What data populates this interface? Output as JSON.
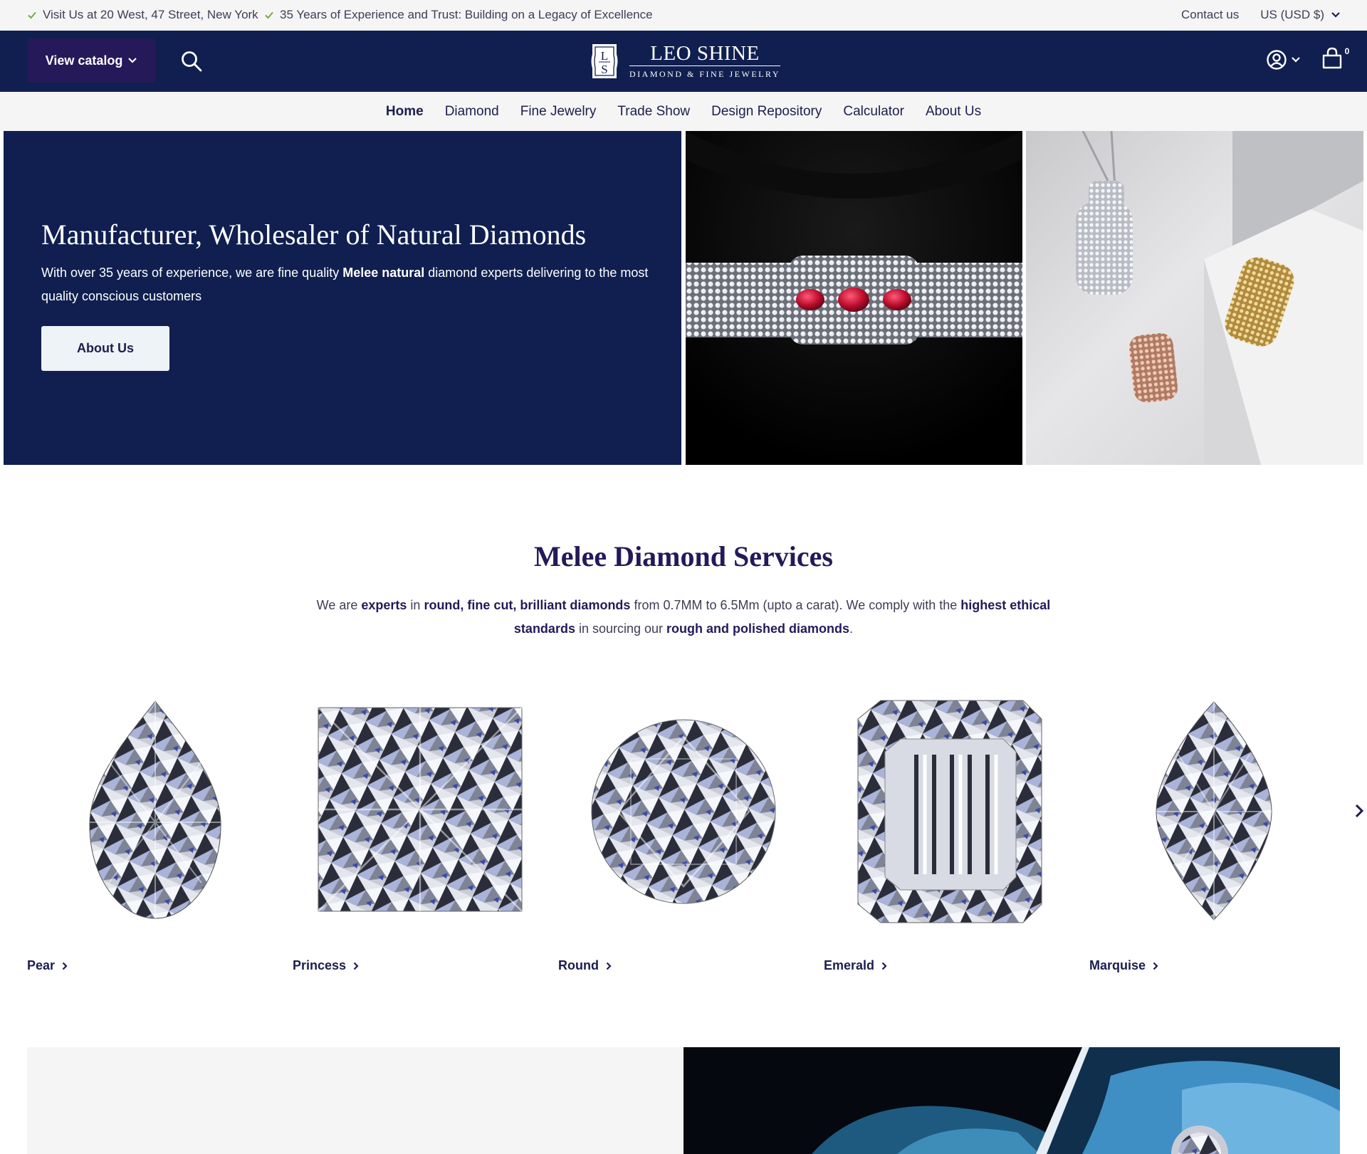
{
  "announcement": {
    "items": [
      "Visit Us at 20 West, 47 Street, New York",
      "35 Years of Experience and Trust: Building on a Legacy of Excellence"
    ],
    "contact": "Contact us",
    "currency": "US (USD $)",
    "check_color": "#6fae3a"
  },
  "header": {
    "catalog_label": "View catalog",
    "logo": {
      "monogram_top": "L",
      "monogram_bottom": "S",
      "brand": "LEO SHINE",
      "tagline": "DIAMOND & FINE JEWELRY"
    },
    "cart_count": "0",
    "background": "#101f4f"
  },
  "nav": {
    "items": [
      "Home",
      "Diamond",
      "Fine Jewelry",
      "Trade Show",
      "Design Repository",
      "Calculator",
      "About Us"
    ],
    "active": "Home"
  },
  "hero": {
    "title": "Manufacturer, Wholesaler of Natural Diamonds",
    "text_before": "With over 35 years of experience, we are fine quality ",
    "text_bold": "Melee natural",
    "text_after": " diamond experts delivering to the most quality conscious customers",
    "button": "About Us",
    "image1": "ruby-diamond-choker-image",
    "image2": "diamond-pendants-image"
  },
  "services": {
    "title": "Melee Diamond Services",
    "text": [
      {
        "t": "We are ",
        "b": false
      },
      {
        "t": "experts",
        "b": true
      },
      {
        "t": " in ",
        "b": false
      },
      {
        "t": "round, fine cut, brilliant diamonds",
        "b": true
      },
      {
        "t": " from 0.7MM to 6.5Mm (upto a carat). We comply with the ",
        "b": false
      },
      {
        "t": "highest ethical standards",
        "b": true
      },
      {
        "t": " in sourcing our ",
        "b": false
      },
      {
        "t": "rough and polished diamonds",
        "b": true
      },
      {
        "t": ".",
        "b": false
      }
    ],
    "shapes": [
      {
        "name": "Pear",
        "icon": "pear-diamond-icon"
      },
      {
        "name": "Princess",
        "icon": "princess-diamond-icon"
      },
      {
        "name": "Round",
        "icon": "round-diamond-icon"
      },
      {
        "name": "Emerald",
        "icon": "emerald-diamond-icon"
      },
      {
        "name": "Marquise",
        "icon": "marquise-diamond-icon"
      }
    ]
  }
}
